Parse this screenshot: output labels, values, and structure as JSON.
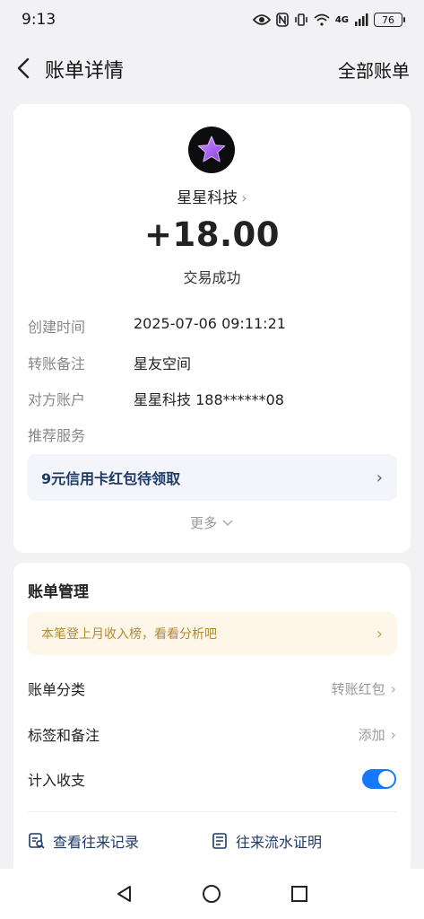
{
  "status_bar": {
    "time": "9:13",
    "network": "4G",
    "battery": "76"
  },
  "header": {
    "title": "账单详情",
    "right_link": "全部账单"
  },
  "transaction": {
    "merchant": "星星科技",
    "amount": "+18.00",
    "status": "交易成功",
    "details": [
      {
        "label": "创建时间",
        "value": "2025-07-06 09:11:21"
      },
      {
        "label": "转账备注",
        "value": "星友空间"
      },
      {
        "label": "对方账户",
        "value": "星星科技 188******08"
      },
      {
        "label": "推荐服务",
        "value": ""
      }
    ],
    "promo": "9元信用卡红包待领取",
    "more": "更多"
  },
  "management": {
    "title": "账单管理",
    "tip": "本笔登上月收入榜，看看分析吧",
    "category_label": "账单分类",
    "category_value": "转账红包",
    "tags_label": "标签和备注",
    "tags_value": "添加",
    "count_label": "计入收支",
    "count_enabled": true,
    "links": [
      "查看往来记录",
      "往来流水证明"
    ]
  },
  "colors": {
    "accent": "#1677ff",
    "promo_text": "#1e3a66",
    "tip_bg": "#fdf7ea",
    "tip_text": "#b38a2e",
    "logo_star": "#a24ff0"
  },
  "icons": [
    "back-arrow-icon",
    "star-logo-icon",
    "chevron-right-icon",
    "chevron-down-icon",
    "records-search-icon",
    "statement-icon",
    "nav-back-icon",
    "nav-home-icon",
    "nav-recent-icon"
  ]
}
